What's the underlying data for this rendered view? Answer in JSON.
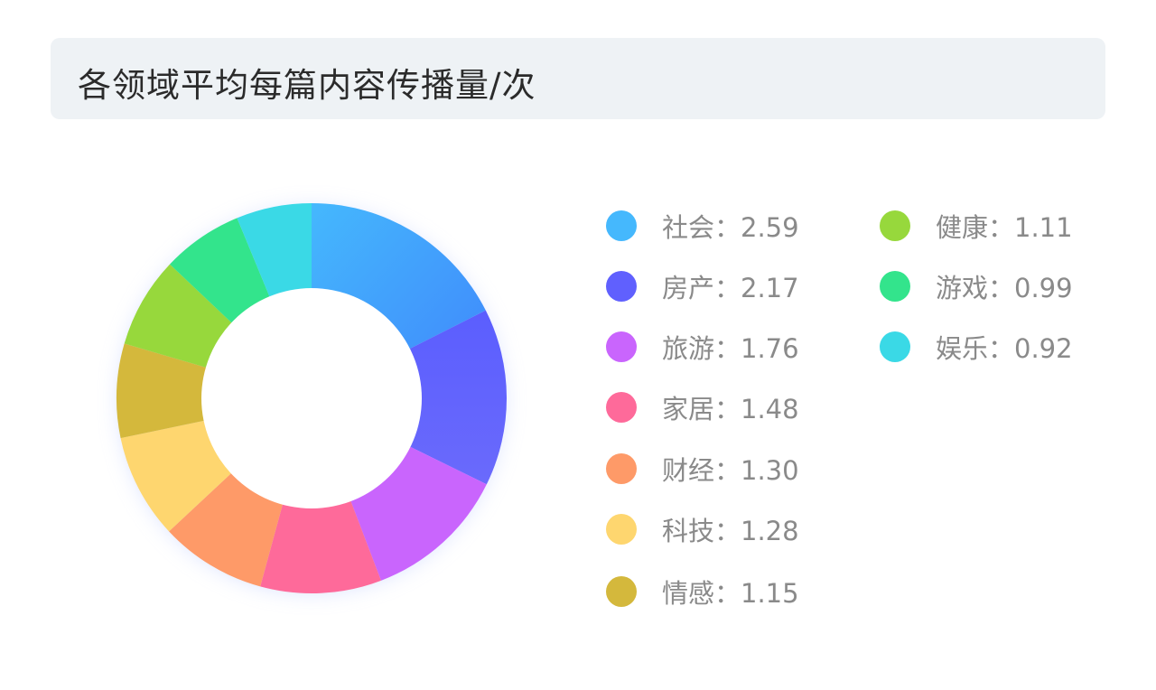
{
  "title": "各领域平均每篇内容传播量/次",
  "chart_data": {
    "type": "pie",
    "variant": "donut",
    "title": "各领域平均每篇内容传播量/次",
    "separator": "：",
    "legend_position": "right",
    "categories": [
      "社会",
      "房产",
      "旅游",
      "家居",
      "财经",
      "科技",
      "情感",
      "健康",
      "游戏",
      "娱乐"
    ],
    "values": [
      2.59,
      2.17,
      1.76,
      1.48,
      1.3,
      1.28,
      1.15,
      1.11,
      0.99,
      0.92
    ],
    "value_labels": [
      "2.59",
      "2.17",
      "1.76",
      "1.48",
      "1.30",
      "1.28",
      "1.15",
      "1.11",
      "0.99",
      "0.92"
    ],
    "colors": [
      "#45b8fd",
      "#6060fe",
      "#c965fd",
      "#fe6a9a",
      "#fe9a68",
      "#fed66f",
      "#d4b83c",
      "#97d83c",
      "#33e48c",
      "#3ad9e6"
    ]
  }
}
